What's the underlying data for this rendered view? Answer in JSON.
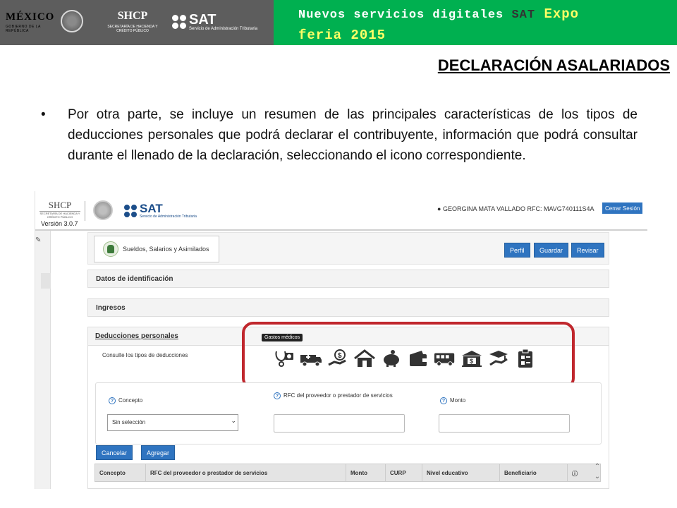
{
  "banner": {
    "mexico": "MÉXICO",
    "mexico_sub": "GOBIERNO DE LA REPÚBLICA",
    "shcp": "SHCP",
    "shcp_sub": "SECRETARÍA DE HACIENDA Y CRÉDITO PÚBLICO",
    "sat": "SAT",
    "sat_sub": "Servicio de Administración Tributaria",
    "title_part1": "Nuevos servicios digitales ",
    "title_sat": "SAT",
    "title_expo": " Expo",
    "title_line2": "feria 2015",
    "accent_color": "#00b050"
  },
  "slide": {
    "heading": "DECLARACIÓN ASALARIADOS",
    "bullet": "•",
    "paragraph": "Por otra parte, se incluye un resumen de las principales características de los tipos de deducciones personales que podrá declarar el contribuyente, información que podrá consultar durante el llenado de la declaración, seleccionando el icono correspondiente."
  },
  "app": {
    "shcp": "SHCP",
    "shcp_sub": "SECRETARÍA DE HACIENDA Y CRÉDITO PÚBLICO",
    "version": "Versión 3.0.7",
    "sat": "SAT",
    "sat_sub": "Servicio de Administración Tributaria",
    "user": "GEORGINA MATA VALLADO RFC: MAVG740111S4A",
    "logout": "Cerrar Sesión",
    "regime": "Sueldos, Salarios y Asimilados",
    "buttons": {
      "perfil": "Perfil",
      "guardar": "Guardar",
      "revisar": "Revisar"
    },
    "panels": {
      "identificacion": "Datos de identificación",
      "ingresos": "Ingresos",
      "deducciones": "Deducciones personales"
    },
    "consulte": "Consulte los tipos de deducciones",
    "tooltip": "Gastos médicos",
    "deduction_icons": [
      "medical-icon",
      "ambulance-icon",
      "money-hand-icon",
      "house-icon",
      "piggy-bank-icon",
      "wallet-icon",
      "bus-icon",
      "bank-icon",
      "education-icon",
      "clipboard-icon"
    ],
    "form": {
      "concepto_label": "Concepto",
      "concepto_value": "Sin selección",
      "rfc_label": "RFC del proveedor o prestador de servicios",
      "monto_label": "Monto"
    },
    "actions": {
      "cancelar": "Cancelar",
      "agregar": "Agregar"
    },
    "table_headers": [
      "Concepto",
      "RFC del proveedor o prestador de servicios",
      "Monto",
      "CURP",
      "Nivel educativo",
      "Beneficiario",
      ""
    ],
    "highlight_color": "#c0272d"
  }
}
